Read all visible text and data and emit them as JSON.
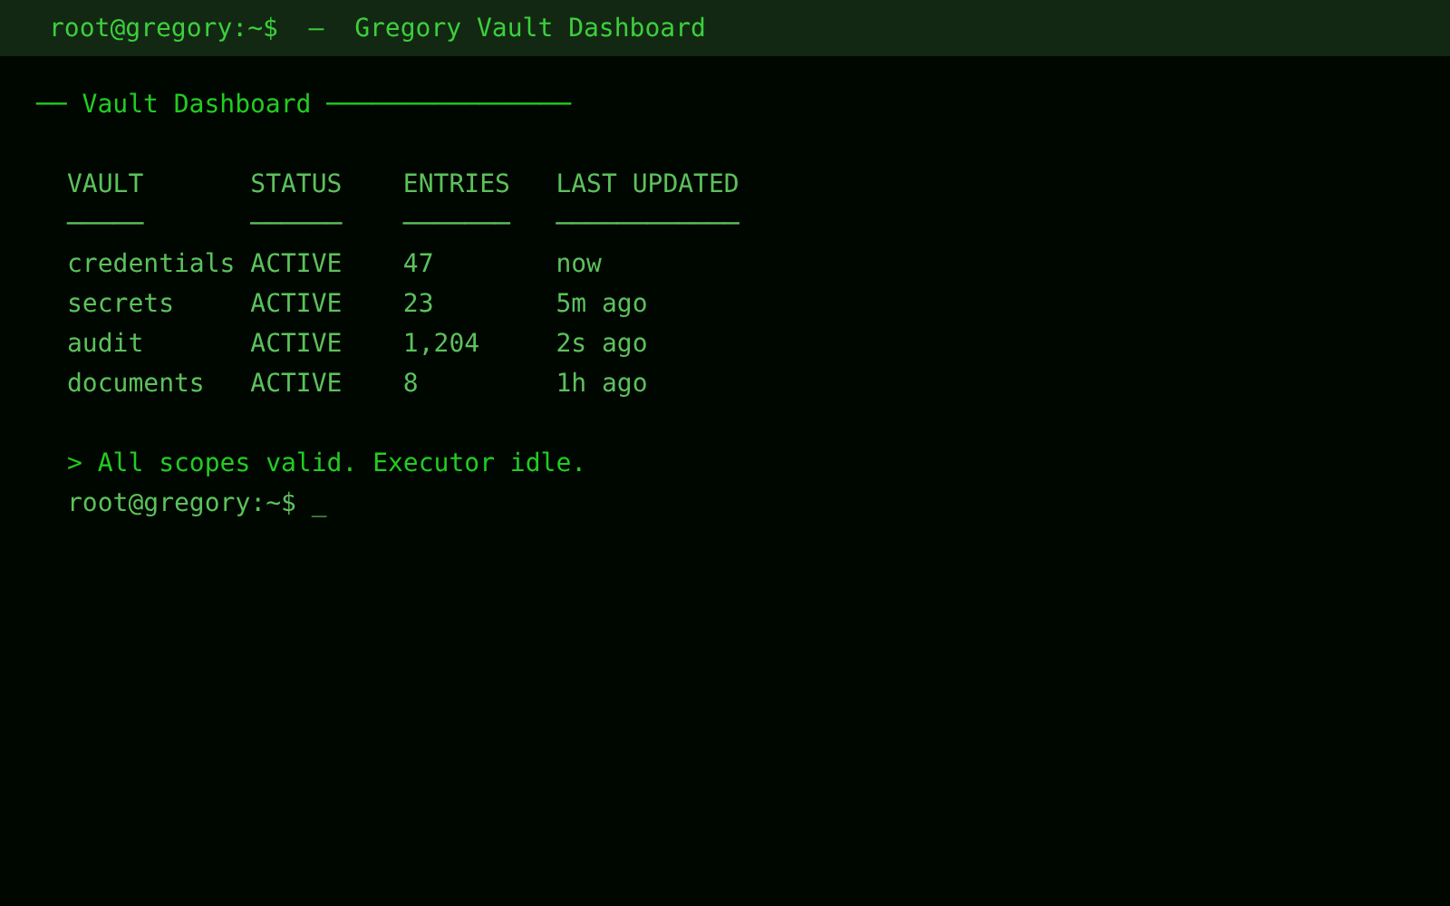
{
  "window": {
    "title": "root@gregory:~$  —  Gregory Vault Dashboard"
  },
  "section_heading": {
    "lead": "──",
    "title": "Vault Dashboard",
    "trail": "────────────────"
  },
  "table": {
    "columns": [
      {
        "label": "VAULT",
        "underline": "─────"
      },
      {
        "label": "STATUS",
        "underline": "──────"
      },
      {
        "label": "ENTRIES",
        "underline": "───────"
      },
      {
        "label": "LAST UPDATED",
        "underline": "────────────"
      }
    ],
    "rows": [
      [
        "credentials",
        "ACTIVE",
        "47",
        "now"
      ],
      [
        "secrets",
        "ACTIVE",
        "23",
        "5m ago"
      ],
      [
        "audit",
        "ACTIVE",
        "1,204",
        "2s ago"
      ],
      [
        "documents",
        "ACTIVE",
        "8",
        "1h ago"
      ]
    ]
  },
  "status_message": "> All scopes valid. Executor idle.",
  "prompt": {
    "text": "root@gregory:~$",
    "cursor": "_"
  }
}
